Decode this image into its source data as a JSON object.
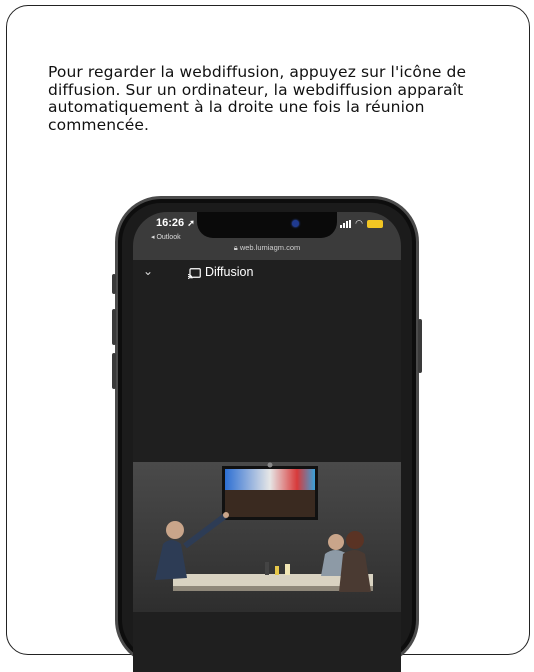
{
  "instruction": {
    "text": "Pour regarder la webdiffusion, appuyez sur l'icône de diffusion. Sur un ordinateur, la webdiffusion apparaît automatiquement à la droite une fois la réunion commencée."
  },
  "phone": {
    "status": {
      "time": "16:26",
      "back_app": "◂ Outlook",
      "url": "web.lumiagm.com",
      "battery_color": "#f3c623"
    },
    "header": {
      "chevron": "⌄",
      "title": "Diffusion"
    }
  }
}
